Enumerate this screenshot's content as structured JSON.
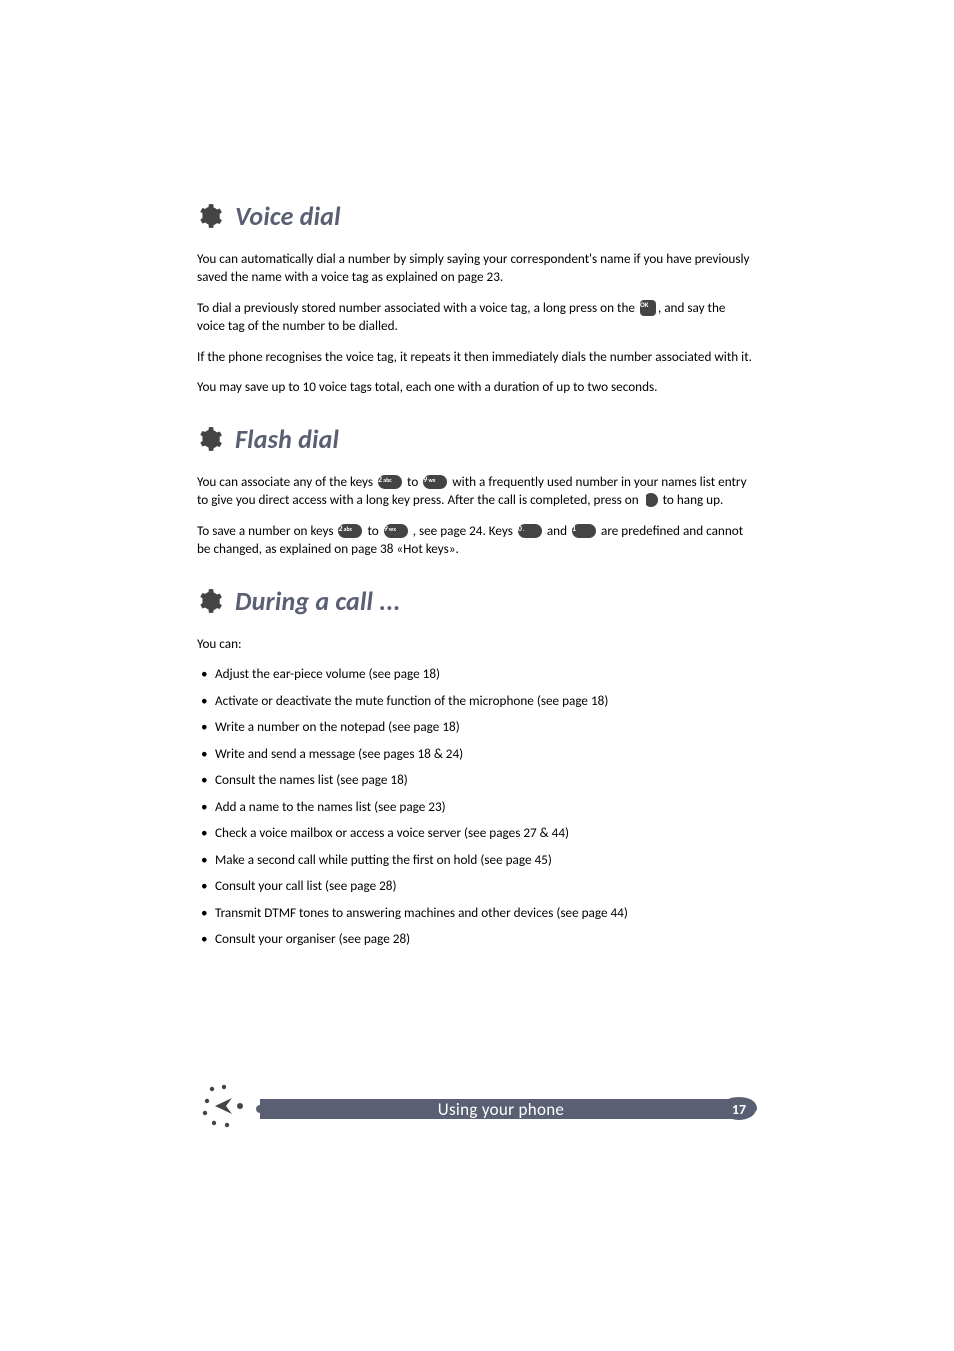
{
  "sections": [
    {
      "heading": "Voice dial",
      "paras": [
        "You can automatically dial a number by simply saying your correspondent's name if you have previously saved the name with a voice tag as explained on page 23.",
        null,
        "If the phone recognises the voice tag, it repeats it then immediately dials the number associated with it.",
        "You may save up to 10 voice tags total, each one with a duration of up to two seconds."
      ],
      "special_para_1": {
        "pre": "To dial a previously stored number associated with a voice tag, a long press on the ",
        "key": "OK",
        "post": ", and say the voice tag of the number to be dialled."
      }
    },
    {
      "heading": "Flash dial",
      "flash_para_1": {
        "pre": "You can associate any of the keys ",
        "key1": "2",
        "mid1": " to ",
        "key2": "9",
        "mid2": " with a frequently used number in your names list entry to give you direct access with a long key press.  After the call is completed, press on ",
        "post": " to hang up."
      },
      "flash_para_2": {
        "pre": "To save a number on keys ",
        "key1": "2",
        "mid1": " to ",
        "key2": "9",
        "mid2": ", see page 24.  Keys ",
        "key3": "0",
        "mid3": " and ",
        "key4": "1",
        "post": " are predefined and cannot be changed, as explained on page 38 «Hot keys»."
      }
    },
    {
      "heading": "During a call ...",
      "intro": "You can:",
      "bullets": [
        "Adjust the ear-piece volume (see page 18)",
        "Activate or deactivate the mute function of the microphone (see page 18)",
        "Write a number on the notepad (see page 18)",
        "Write and send a message (see pages 18 & 24)",
        "Consult the names list (see page 18)",
        "Add a name to the names list (see page 23)",
        "Check a voice mailbox or access a voice server (see pages 27 & 44)",
        "Make a second call while putting the first on hold (see page 45)",
        "Consult your call list (see page 28)",
        "Transmit DTMF tones to answering machines and other devices (see page 44)",
        "Consult your organiser (see page 28)"
      ]
    }
  ],
  "footer": {
    "title": "Using your phone",
    "page_number": "17"
  },
  "keys": {
    "k2": "2",
    "k9": "9",
    "k0": "0",
    "k1": "1",
    "ok": "OK"
  }
}
